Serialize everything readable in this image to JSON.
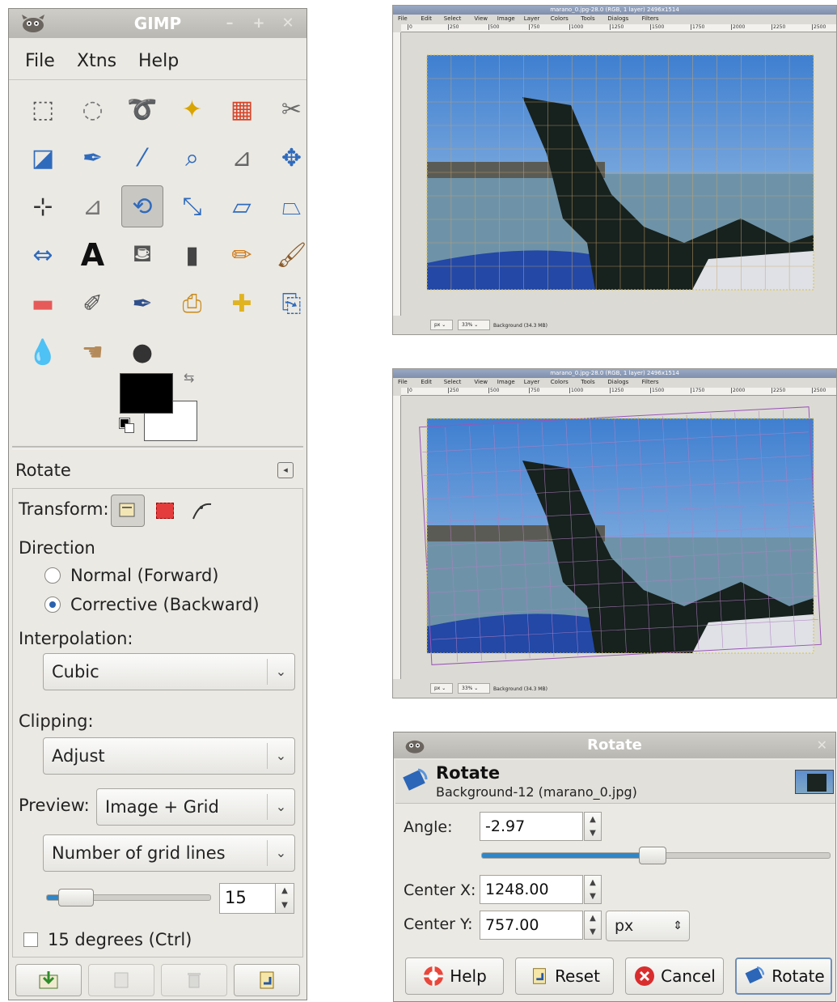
{
  "toolbox": {
    "title": "GIMP",
    "menu": [
      "File",
      "Xtns",
      "Help"
    ],
    "tools": [
      "rect-select-icon",
      "ellipse-select-icon",
      "lasso-icon",
      "fuzzy-select-icon",
      "color-select-icon",
      "scissors-icon",
      "foreground-select-icon",
      "paths-icon",
      "color-picker-icon",
      "zoom-icon",
      "measure-icon",
      "move-icon",
      "align-icon",
      "crop-icon",
      "rotate-icon",
      "scale-icon",
      "shear-icon",
      "perspective-icon",
      "flip-icon",
      "text-icon",
      "bucket-fill-icon",
      "blend-icon",
      "pencil-icon",
      "paintbrush-icon",
      "eraser-icon",
      "airbrush-icon",
      "ink-icon",
      "clone-icon",
      "heal-icon",
      "perspective-clone-icon",
      "blur-icon",
      "smudge-icon",
      "dodge-burn-icon"
    ],
    "selected_tool": "rotate-icon",
    "fg_color": "#000000",
    "bg_color": "#ffffff"
  },
  "options": {
    "title": "Rotate",
    "transform_label": "Transform:",
    "direction_label": "Direction",
    "direction_normal": "Normal (Forward)",
    "direction_corrective": "Corrective (Backward)",
    "direction_selected": "corrective",
    "interpolation_label": "Interpolation:",
    "interpolation_value": "Cubic",
    "clipping_label": "Clipping:",
    "clipping_value": "Adjust",
    "preview_label": "Preview:",
    "preview_value": "Image + Grid",
    "grid_mode_value": "Number of grid lines",
    "grid_lines_value": "15",
    "grid_slider_fraction": 0.12,
    "constrain_label": "15 degrees  (Ctrl)",
    "constrain_checked": false
  },
  "image_window": {
    "title": "marano_0.jpg-28.0 (RGB, 1 layer) 2496x1514",
    "menu": [
      "File",
      "Edit",
      "Select",
      "View",
      "Image",
      "Layer",
      "Colors",
      "Tools",
      "Dialogs",
      "Filters"
    ],
    "ruler_ticks": [
      "0",
      "250",
      "500",
      "750",
      "1000",
      "1250",
      "1500",
      "1750",
      "2000",
      "2250",
      "2500"
    ],
    "unit": "px",
    "zoom": "33%",
    "status": "Background (34.3 MB)"
  },
  "rotate_dialog": {
    "title": "Rotate",
    "heading": "Rotate",
    "subheading": "Background-12 (marano_0.jpg)",
    "angle_label": "Angle:",
    "angle_value": "-2.97",
    "angle_slider_fraction": 0.49,
    "center_x_label": "Center X:",
    "center_x_value": "1248.00",
    "center_y_label": "Center Y:",
    "center_y_value": "757.00",
    "unit_value": "px",
    "help_label": "Help",
    "reset_label": "Reset",
    "cancel_label": "Cancel",
    "rotate_label": "Rotate"
  }
}
